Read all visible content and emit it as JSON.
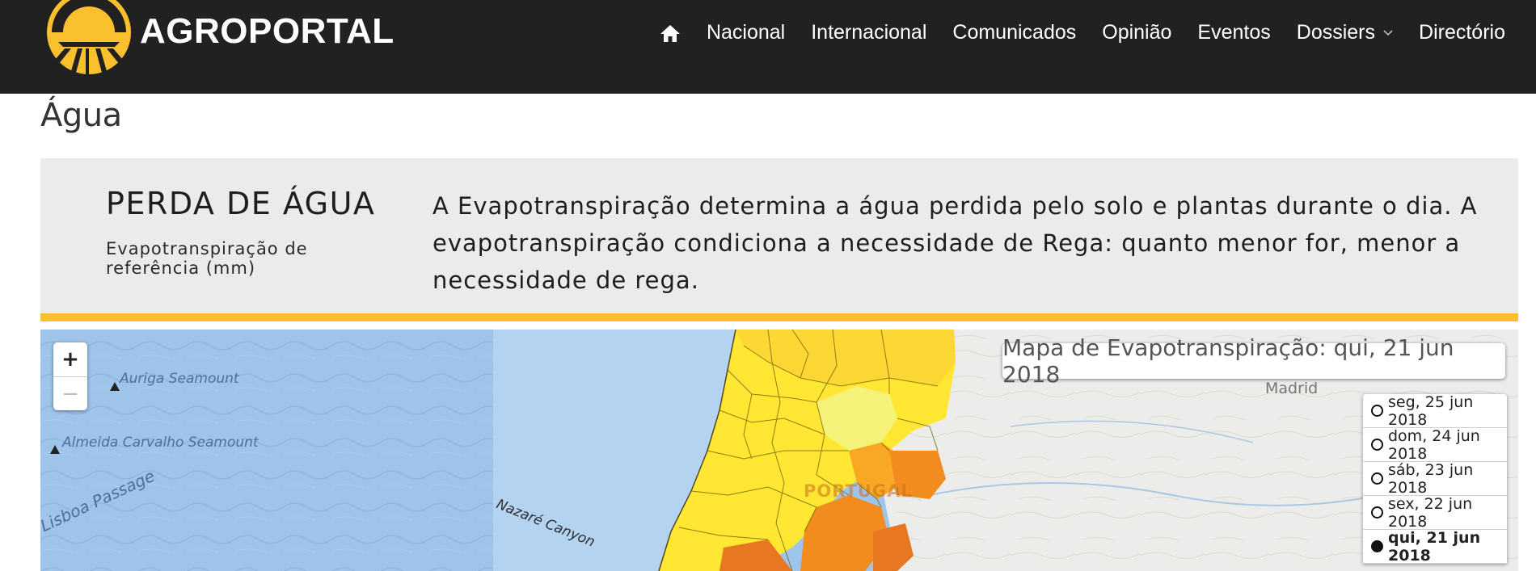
{
  "header": {
    "brand": "AGROPORTAL",
    "logo_color": "#FBC02D",
    "nav": [
      {
        "label": "Nacional"
      },
      {
        "label": "Internacional"
      },
      {
        "label": "Comunicados"
      },
      {
        "label": "Opinião"
      },
      {
        "label": "Eventos"
      },
      {
        "label": "Dossiers",
        "has_dropdown": true
      },
      {
        "label": "Directório"
      }
    ],
    "home_icon": "home-icon"
  },
  "page": {
    "title": "Água"
  },
  "info": {
    "heading": "PERDA DE ÁGUA",
    "subheading": "Evapotranspiração de referência (mm)",
    "description": "A Evapotranspiração determina a água perdida pelo solo e plantas durante o dia. A evapotranspiração condiciona a necessidade de Rega: quanto menor for, menor a necessidade de rega.",
    "accent_color": "#FBC02D"
  },
  "map": {
    "title": "Mapa de Evapotranspiração: qui, 21 jun 2018",
    "zoom_in": "+",
    "zoom_out": "−",
    "dates": [
      {
        "label": "seg, 25 jun 2018",
        "selected": false
      },
      {
        "label": "dom, 24 jun 2018",
        "selected": false
      },
      {
        "label": "sáb, 23 jun 2018",
        "selected": false
      },
      {
        "label": "sex, 22 jun 2018",
        "selected": false
      },
      {
        "label": "qui, 21 jun 2018",
        "selected": true
      }
    ],
    "labels": {
      "auriga": "Auriga Seamount",
      "almeida": "Almeida Carvalho Seamount",
      "lisboa": "Lisboa Passage",
      "nazare": "Nazaré Canyon",
      "portugal": "PORTUGAL",
      "madrid": "Madrid"
    },
    "legend_colors": [
      "#F5F27A",
      "#FFE733",
      "#FDD835",
      "#F9A825",
      "#F28C1E",
      "#E87722"
    ]
  }
}
